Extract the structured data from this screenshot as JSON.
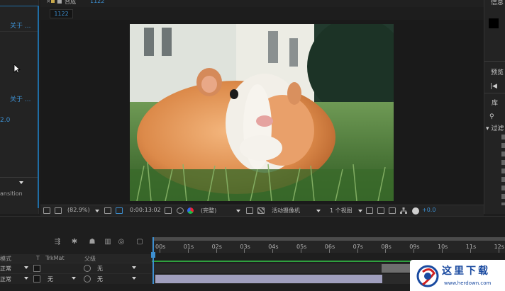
{
  "left_panel": {
    "link1": "关于 ...",
    "link2": "关于 ...",
    "version": "2.0",
    "label": "ansition"
  },
  "composition": {
    "tab_name": "合成",
    "tab_number": "1122",
    "chip": "1122"
  },
  "viewer_bar": {
    "zoom": "(82.9%)",
    "timecode": "0:00:13:02",
    "resolution": "(完整)",
    "camera": "活动摄像机",
    "views": "1 个视图",
    "exposure": "+0.0"
  },
  "right_panel": {
    "info": "信息",
    "preview": "预览",
    "library": "库",
    "filter": "▾ 过滤"
  },
  "timeline": {
    "columns": {
      "mode": "模式",
      "t": "T",
      "trkmat": "TrkMat",
      "parent": "父级"
    },
    "rows": [
      {
        "mode": "正常",
        "trkmat": "",
        "parent": "无"
      },
      {
        "mode": "正常",
        "trkmat": "无",
        "parent": "无"
      }
    ],
    "ruler_labels": [
      "00s",
      "01s",
      "02s",
      "03s",
      "04s",
      "05s",
      "06s",
      "07s",
      "08s",
      "09s",
      "10s",
      "11s",
      "12s"
    ]
  },
  "watermark": {
    "title": "这里下载",
    "url": "www.herdown.com"
  },
  "colors": {
    "accent": "#3d8fd0",
    "green": "#2fa13f",
    "layer_bar": "#a09fbe"
  }
}
